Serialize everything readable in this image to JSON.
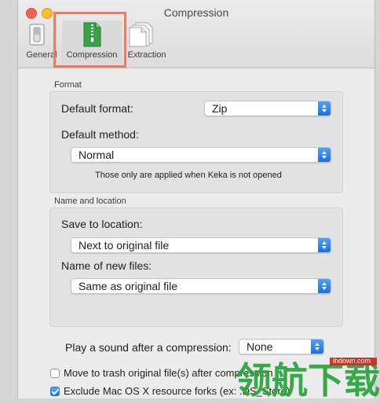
{
  "window": {
    "title": "Compression"
  },
  "toolbar": {
    "items": [
      {
        "label": "General",
        "icon": "switch-icon"
      },
      {
        "label": "Compression",
        "icon": "zip-archive-icon",
        "selected": true
      },
      {
        "label": "Extraction",
        "icon": "documents-icon"
      }
    ]
  },
  "format": {
    "section_label": "Format",
    "default_format_label": "Default format:",
    "default_format_value": "Zip",
    "default_method_label": "Default method:",
    "default_method_value": "Normal",
    "note": "Those only are applied when Keka is not opened"
  },
  "name_location": {
    "section_label": "Name and location",
    "save_to_label": "Save to location:",
    "save_to_value": "Next to original file",
    "name_files_label": "Name of new files:",
    "name_files_value": "Same as original file"
  },
  "sound": {
    "label": "Play a sound after a compression:",
    "value": "None"
  },
  "options": {
    "move_to_trash_label": "Move to trash original file(s) after compression",
    "move_to_trash_checked": false,
    "exclude_forks_label": "Exclude Mac OS X resource forks (ex: .DS_Store)",
    "exclude_forks_checked": true
  },
  "watermark": {
    "site": "ihdown.com",
    "chinese": "领航下载"
  },
  "colors": {
    "highlight": "#f07a62",
    "accent": "#1b6fe0",
    "watermark_green": "#27a53c"
  }
}
